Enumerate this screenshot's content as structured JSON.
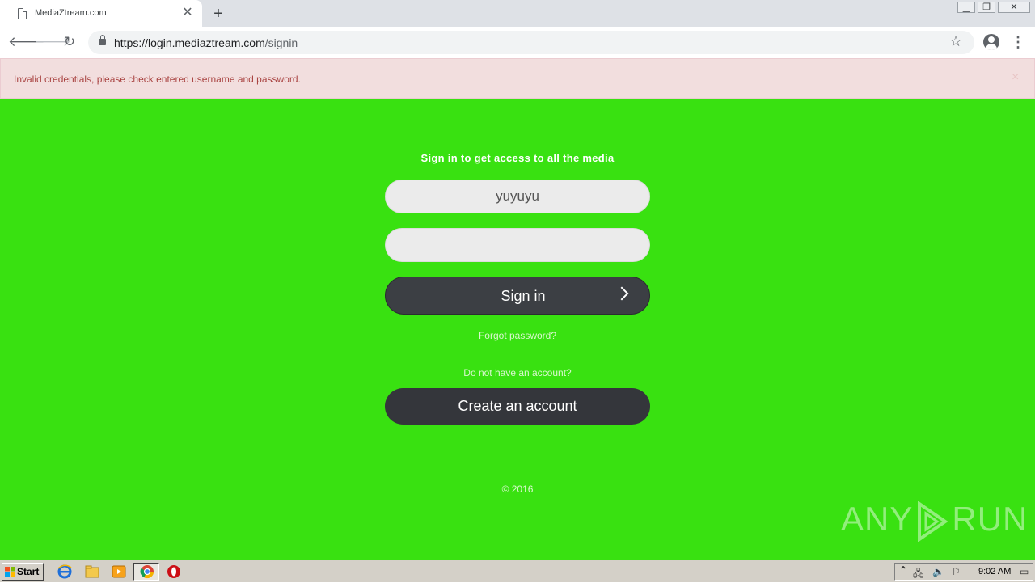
{
  "browser": {
    "tab_title": "MediaZtream.com",
    "tab_close": "✕",
    "new_tab": "+",
    "url_host": "https://login.mediaztream.com",
    "url_path": "/signin"
  },
  "alert": {
    "message": "Invalid credentials, please check entered username and password.",
    "close": "×"
  },
  "form": {
    "heading": "Sign in to get access to all the media",
    "username_value": "yuyuyu",
    "password_value": "",
    "signin_label": "Sign in",
    "forgot_password": "Forgot password?",
    "no_account": "Do not have an account?",
    "create_account": "Create an account",
    "copyright": "© 2016"
  },
  "watermark": {
    "left": "ANY",
    "right": "RUN"
  },
  "taskbar": {
    "start_label": "Start",
    "clock": "9:02 AM"
  },
  "colors": {
    "page_background": "#39e111",
    "alert_background": "#f2dede",
    "alert_text": "#a94442",
    "button_dark": "#3c3f44"
  }
}
